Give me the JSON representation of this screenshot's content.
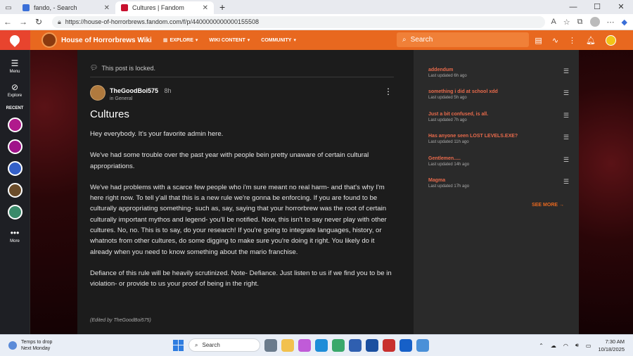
{
  "browser": {
    "tabs": [
      {
        "title": "fando, - Search",
        "favicon_color": "#3a6fd8"
      },
      {
        "title": "Cultures | Fandom",
        "favicon_color": "#c8102e"
      }
    ],
    "url": "https://house-of-horrorbrews.fandom.com/f/p/4400000000000155508"
  },
  "rail": {
    "menu_label": "More",
    "home_label": "Menu",
    "explore_label": "Explore",
    "recent_label": "RECENT",
    "recent_colors": [
      "#b01a8c",
      "#a0138a",
      "#3460c8",
      "#6b4c2a",
      "#3a8a6a"
    ]
  },
  "wiki": {
    "name": "House of Horrorbrews Wiki",
    "nav": [
      "EXPLORE",
      "WIKI CONTENT",
      "COMMUNITY"
    ],
    "search_placeholder": "Search"
  },
  "post": {
    "locked_text": "This post is locked.",
    "author": "TheGoodBoi575",
    "time": "8h",
    "category": "in General",
    "title": "Cultures",
    "paragraphs": [
      "Hey everybody. It's your favorite admin here.",
      "We've had some trouble over the past year with people bein pretty unaware of certain cultural appropriations.",
      "We've had problems with a scarce few people who i'm sure meant no real harm- and that's why I'm here right now. To tell y'all that this is a new rule we're gonna be enforcing. If you are found to be culturally appropriating something- such as, say, saying that your horrorbrew was the root of certain culturally important mythos and legend- you'll be notified. Now, this isn't to say never play with other cultures. No, no. This is to say, do your research! If you're going to integrate languages, history, or whatnots from other cultures, do some digging to make sure you're doing it right. You likely do it already when you need to know something about the mario franchise.",
      "Defiance of this rule will be heavily scrutinized. Note- Defiance. Just listen to us if we find you to be in violation- or provide to us your proof of being in the right."
    ],
    "edited": "(Edited by TheGoodBoi575)"
  },
  "sidebar": {
    "items": [
      {
        "title": "addendum",
        "meta": "Last updated 6h ago"
      },
      {
        "title": "something i did at school xdd",
        "meta": "Last updated 5h ago"
      },
      {
        "title": "Just a bit confused, is all.",
        "meta": "Last updated 7h ago"
      },
      {
        "title": "Has anyone seen LOST LEVELS.EXE?",
        "meta": "Last updated 11h ago"
      },
      {
        "title": "Gentlemen.....",
        "meta": "Last updated 14h ago"
      },
      {
        "title": "Magma",
        "meta": "Last updated 17h ago"
      }
    ],
    "see_more": "SEE MORE"
  },
  "taskbar": {
    "weather_line1": "Temps to drop",
    "weather_line2": "Next Monday",
    "weather_badge": "3",
    "search_label": "Search",
    "time": "7:30 AM",
    "date": "10/18/2025"
  }
}
